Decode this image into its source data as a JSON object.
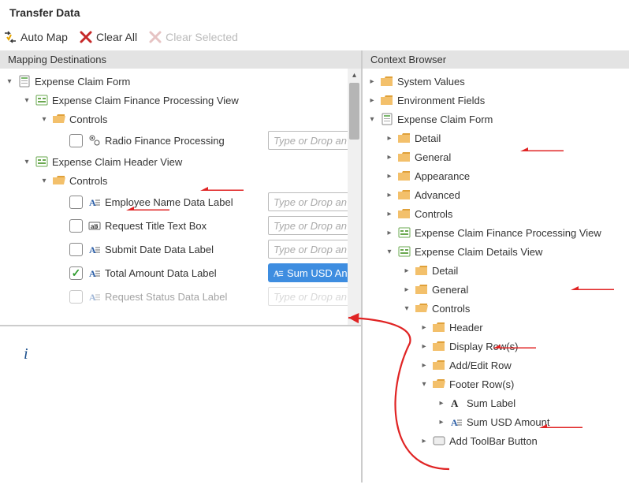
{
  "title": "Transfer Data",
  "toolbar": {
    "automap": "Auto Map",
    "clearAll": "Clear All",
    "clearSelected": "Clear Selected"
  },
  "panels": {
    "left": "Mapping Destinations",
    "right": "Context Browser"
  },
  "ph": "Type or Drop an",
  "token": "Sum USD An",
  "info": "i",
  "left": {
    "root": "Expense Claim Form",
    "finView": "Expense Claim Finance Processing View",
    "controls": "Controls",
    "radio": "Radio Finance Processing",
    "headerView": "Expense Claim Header View",
    "emp": "Employee Name Data Label",
    "req": "Request Title Text Box",
    "submit": "Submit Date Data Label",
    "total": "Total Amount Data Label",
    "status": "Request Status Data Label"
  },
  "right": {
    "sys": "System Values",
    "env": "Environment Fields",
    "form": "Expense Claim Form",
    "detail": "Detail",
    "general": "General",
    "appearance": "Appearance",
    "advanced": "Advanced",
    "controls": "Controls",
    "finView": "Expense Claim Finance Processing View",
    "detView": "Expense Claim Details View",
    "header": "Header",
    "display": "Display Row(s)",
    "addedit": "Add/Edit Row",
    "footer": "Footer Row(s)",
    "sumLabel": "Sum Label",
    "sumUsd": "Sum USD Amount",
    "addTb": "Add ToolBar Button"
  }
}
